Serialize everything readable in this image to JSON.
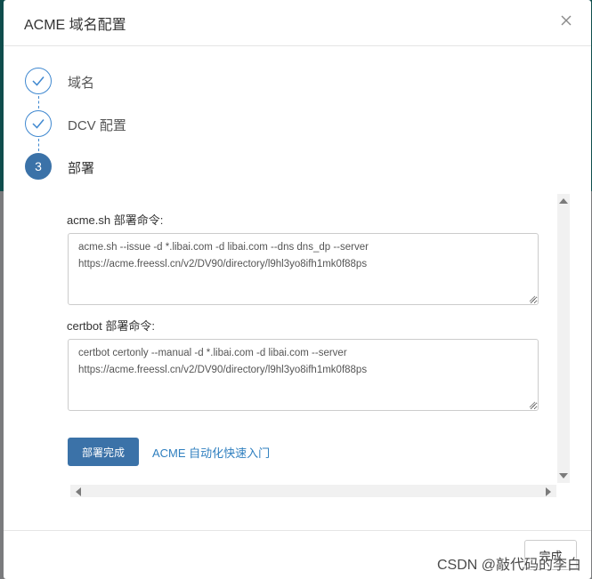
{
  "dialog": {
    "title": "ACME 域名配置",
    "close_icon": "close-icon"
  },
  "steps": [
    {
      "label": "域名",
      "state": "done",
      "icon": "checkmark-icon"
    },
    {
      "label": "DCV 配置",
      "state": "done",
      "icon": "checkmark-icon"
    },
    {
      "label": "部署",
      "state": "active",
      "number": "3"
    }
  ],
  "acme_sh": {
    "label": "acme.sh 部署命令:",
    "line1": "acme.sh --issue -d *.libai.com -d libai.com  --dns dns_dp --server",
    "line2": "https://acme.freessl.cn/v2/DV90/directory/l9hl3yo8ifh1mk0f88ps"
  },
  "certbot": {
    "label": "certbot 部署命令:",
    "line1": "certbot certonly --manual -d *.libai.com -d libai.com  --server",
    "line2": "https://acme.freessl.cn/v2/DV90/directory/l9hl3yo8ifh1mk0f88ps"
  },
  "actions": {
    "done_label": "部署完成",
    "guide_link": "ACME 自动化快速入门"
  },
  "footer": {
    "finish_label": "完成"
  },
  "watermark": "CSDN @敲代码的李白",
  "colors": {
    "primary": "#3b72a8",
    "link": "#2f7fbf",
    "step_border": "#3f88d0"
  }
}
